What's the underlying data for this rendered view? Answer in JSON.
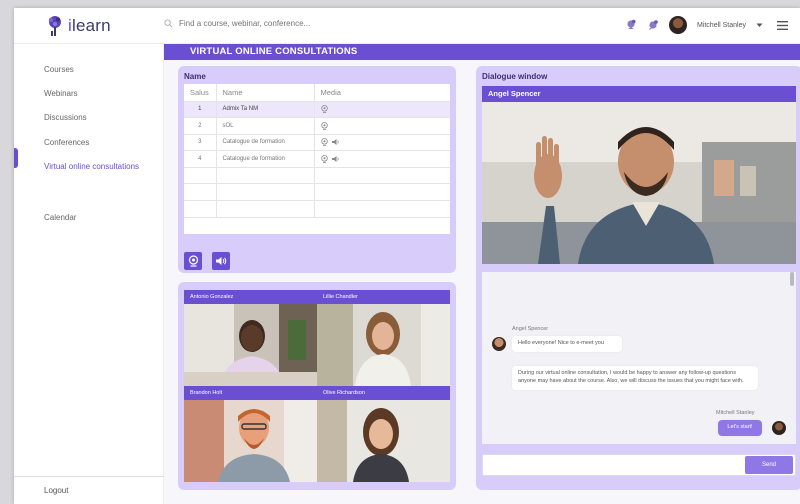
{
  "app": {
    "logo_text": "learn",
    "logo_prefix": "i"
  },
  "header": {
    "search_placeholder": "Find a course, webinar, conference...",
    "user_name": "Mitchell Stanley"
  },
  "sidebar": {
    "items": [
      {
        "label": "Courses"
      },
      {
        "label": "Webinars"
      },
      {
        "label": "Discussions"
      },
      {
        "label": "Conferences"
      },
      {
        "label": "Virtual online consultations"
      },
      {
        "label": "Calendar"
      }
    ],
    "logout": "Logout"
  },
  "page_title": "VIRTUAL ONLINE CONSULTATIONS",
  "table_panel": {
    "title": "Name",
    "columns": [
      "Salus",
      "Name",
      "Media"
    ],
    "rows": [
      {
        "num": "1",
        "name": "Admix Ta NM"
      },
      {
        "num": "2",
        "name": "sOL"
      },
      {
        "num": "3",
        "name": "Catalogue de formation"
      },
      {
        "num": "4",
        "name": "Catalogue de formation"
      }
    ]
  },
  "participants": [
    {
      "name": "Antonio Gonzalez"
    },
    {
      "name": "Lillie Chandler"
    },
    {
      "name": "Brandon Holt"
    },
    {
      "name": "Olive Richardson"
    }
  ],
  "dialogue": {
    "title": "Dialogue window",
    "speaker": "Angel Spencer",
    "messages": [
      {
        "author": "Angel Spencer",
        "text": "Hello everyone! Nice to e-meet you"
      },
      {
        "author": "",
        "text": "During our virtual online consultation, I would be happy to answer any follow-up questions anyone may have about the course. Also, we will discuss the issues that you might face with."
      },
      {
        "author": "Mitchell Stanley",
        "text": "Let's start!"
      }
    ],
    "send_label": "Send",
    "input_value": ""
  },
  "colors": {
    "accent": "#6a4fd3",
    "panel": "#d8cdfa"
  }
}
